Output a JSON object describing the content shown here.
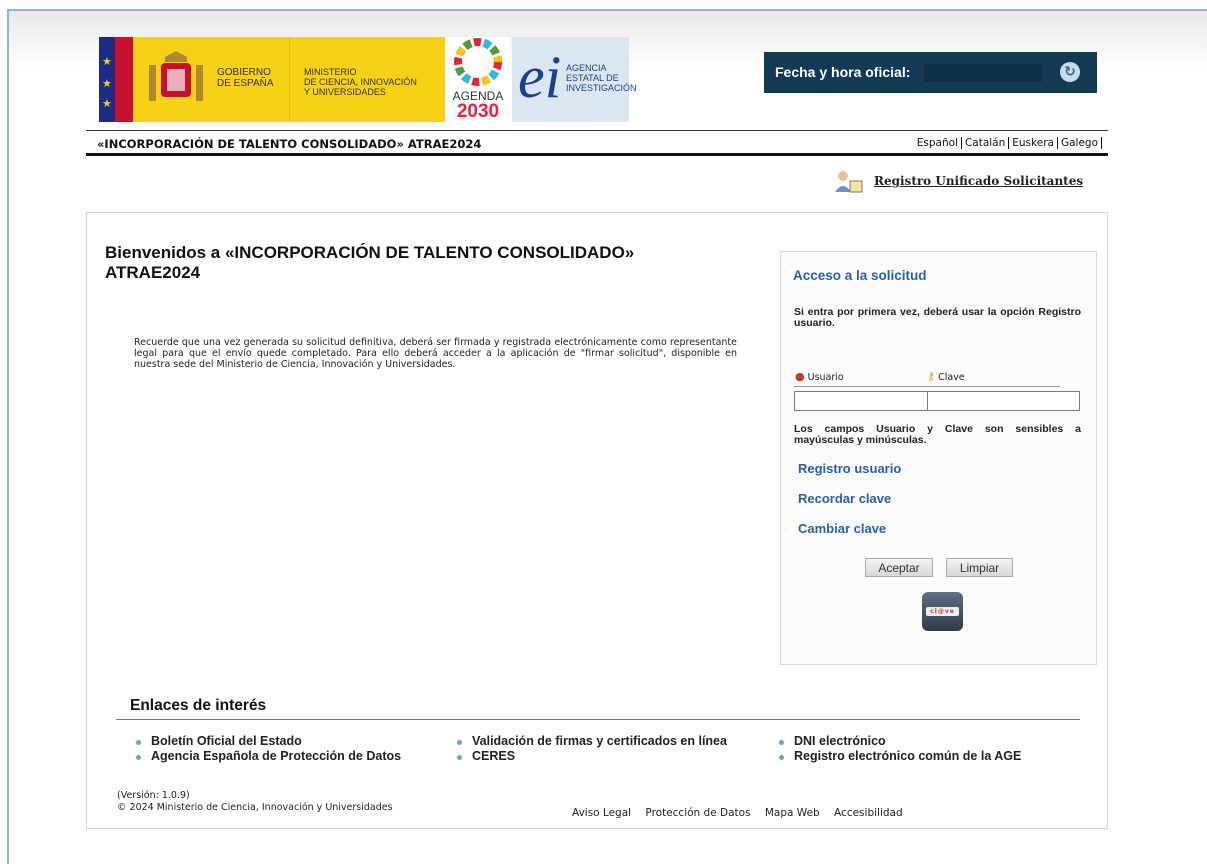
{
  "header": {
    "gobierno": [
      "GOBIERNO",
      "DE ESPAÑA"
    ],
    "ministerio": [
      "MINISTERIO",
      "DE CIENCIA, INNOVACIÓN",
      "Y UNIVERSIDADES"
    ],
    "agenda": [
      "AGENDA",
      "2030"
    ],
    "aei_mark": "ei",
    "aei": [
      "AGENCIA",
      "ESTATAL DE",
      "INVESTIGACIÓN"
    ],
    "clock_label": "Fecha y hora oficial:",
    "clock_value": "",
    "refresh_icon": "refresh-icon"
  },
  "titlebar": {
    "title": "«INCORPORACIÓN DE TALENTO CONSOLIDADO» ATRAE2024",
    "languages": [
      "Español",
      "Catalán",
      "Euskera",
      "Galego"
    ]
  },
  "registro_link": "Registro Unificado Solicitantes",
  "welcome": {
    "title": "Bienvenidos a «INCORPORACIÓN DE TALENTO CONSOLIDADO» ATRAE2024",
    "info": "Recuerde que una vez generada su solicitud definitiva, deberá ser firmada y registrada electrónicamente como representante legal para que el envío quede completado. Para ello deberá acceder a la aplicación de \"firmar solicitud\", disponible en nuestra sede del Ministerio de Ciencia, Innovación y Universidades."
  },
  "login": {
    "title": "Acceso a la solicitud",
    "first_time": "Si entra por primera vez, deberá usar la opción Registro usuario.",
    "usuario_label": "Usuario",
    "clave_label": "Clave",
    "usuario_value": "",
    "clave_value": "",
    "case_note": "Los campos Usuario y Clave son sensibles a mayúsculas y minúsculas.",
    "links": [
      "Registro usuario",
      "Recordar clave",
      "Cambiar clave"
    ],
    "aceptar": "Aceptar",
    "limpiar": "Limpiar",
    "clave_logo": "cl@ve"
  },
  "enlaces": {
    "title": "Enlaces de interés",
    "col1": [
      "Boletín Oficial del Estado",
      "Agencia Española de Protección de Datos"
    ],
    "col2": [
      "Validación de firmas y certificados en línea",
      "CERES"
    ],
    "col3": [
      "DNI electrónico",
      "Registro electrónico común de la AGE"
    ]
  },
  "footer": {
    "version": "(Versión: 1.0.9)",
    "copyright": "© 2024 Ministerio de Ciencia, Innovación y Universidades",
    "links": [
      "Aviso Legal",
      "Protección de Datos",
      "Mapa Web",
      "Accesibilidad"
    ]
  },
  "colors": {
    "clock_bg": "#123a54",
    "link_blue": "#2a5ea8",
    "gov_yellow": "#f7d117"
  }
}
